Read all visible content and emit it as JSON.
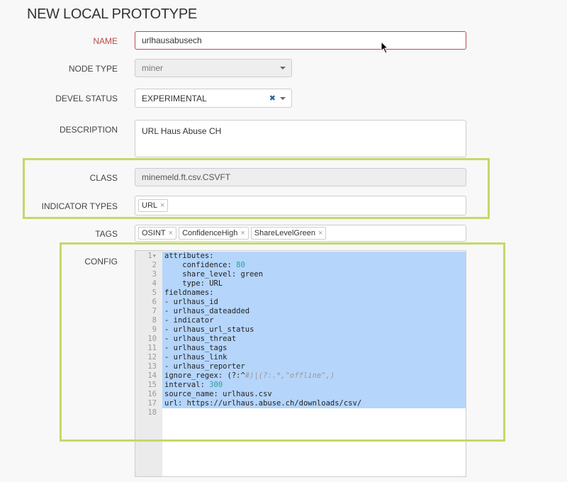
{
  "title": "NEW LOCAL PROTOTYPE",
  "fields": {
    "name": {
      "label": "NAME",
      "value": "urlhausabusech"
    },
    "node_type": {
      "label": "NODE TYPE",
      "value": "miner"
    },
    "devel_status": {
      "label": "DEVEL STATUS",
      "value": "EXPERIMENTAL",
      "clear": "✖"
    },
    "description": {
      "label": "DESCRIPTION",
      "value": "URL Haus Abuse CH"
    },
    "class": {
      "label": "CLASS",
      "value": "minemeld.ft.csv.CSVFT"
    },
    "indicator_types": {
      "label": "INDICATOR TYPES",
      "tags": [
        "URL"
      ]
    },
    "tags": {
      "label": "TAGS",
      "tags": [
        "OSINT",
        "ConfidenceHigh",
        "ShareLevelGreen"
      ]
    },
    "config": {
      "label": "CONFIG",
      "lines": [
        "attributes:",
        "    confidence: 80",
        "    share_level: green",
        "    type: URL",
        "fieldnames:",
        "- urlhaus_id",
        "- urlhaus_dateadded",
        "- indicator",
        "- urlhaus_url_status",
        "- urlhaus_threat",
        "- urlhaus_tags",
        "- urlhaus_link",
        "- urlhaus_reporter",
        "ignore_regex: (?:^#)|(?:.*,\"offline\",)",
        "interval: 300",
        "source_name: urlhaus.csv",
        "url: https://urlhaus.abuse.ch/downloads/csv/",
        ""
      ]
    }
  },
  "colors": {
    "highlight": "#c3d96a",
    "error": "#b94a48",
    "selection": "#b5d5fb"
  }
}
